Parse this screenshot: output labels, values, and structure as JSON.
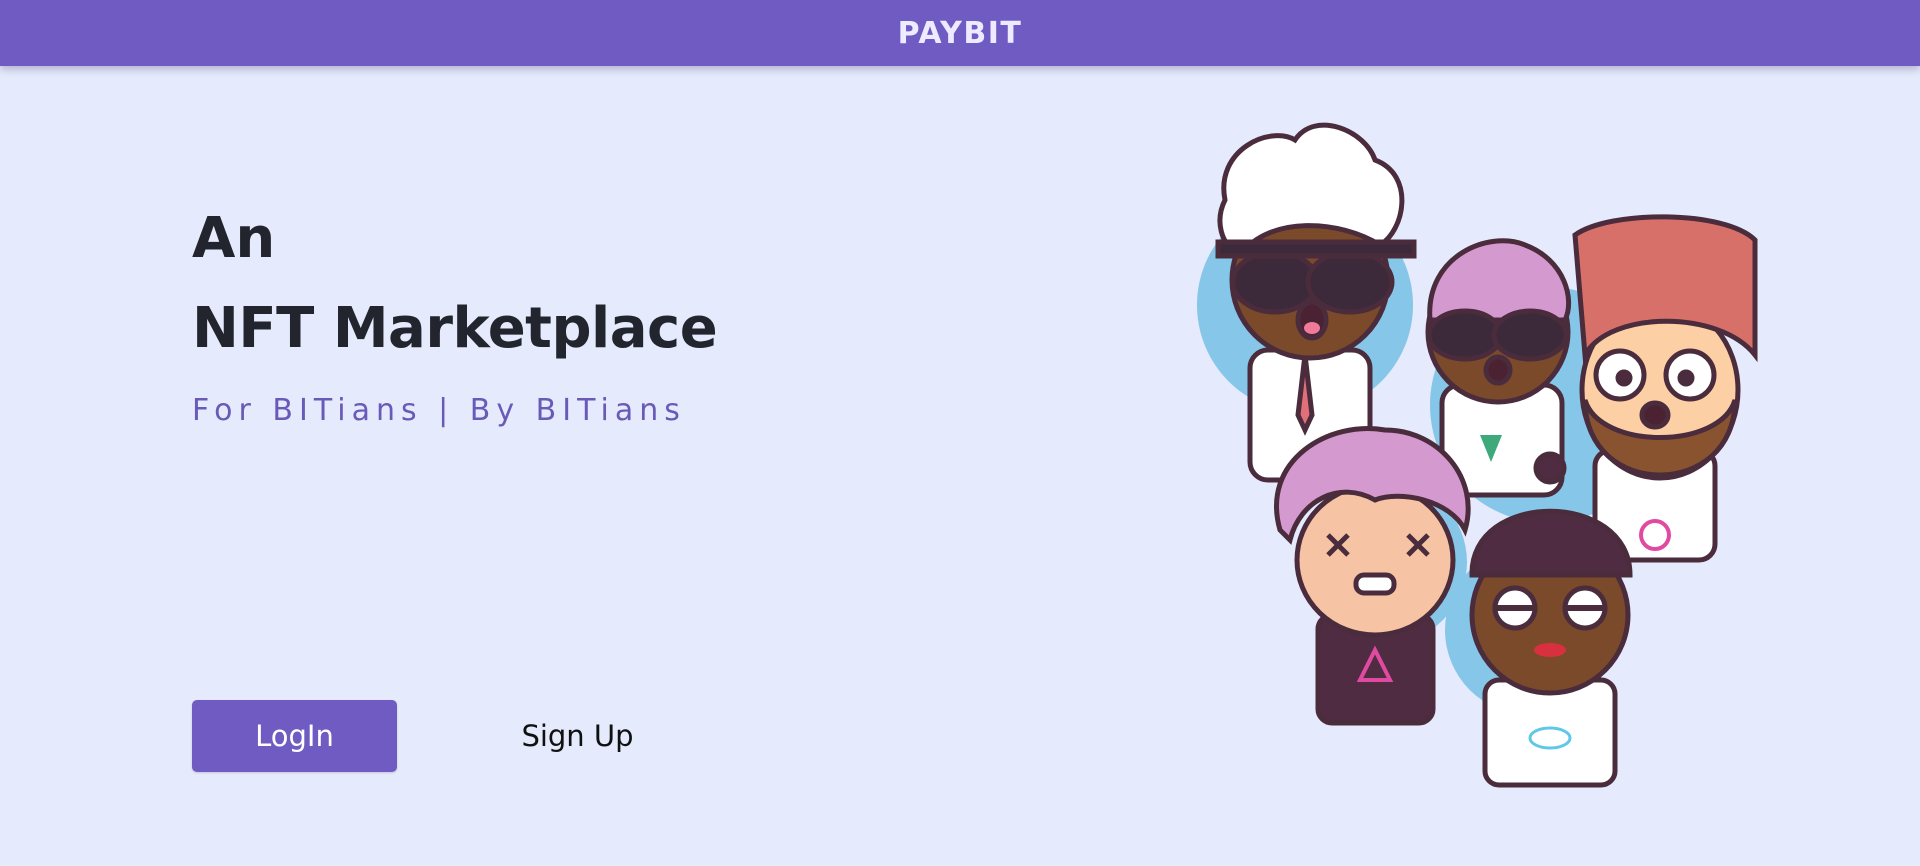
{
  "header": {
    "brand": "PAYBIT"
  },
  "hero": {
    "line1": "An",
    "line2": "NFT Marketplace",
    "tagline": "For BITians | By BITians"
  },
  "actions": {
    "login_label": "LogIn",
    "signup_label": "Sign Up"
  },
  "colors": {
    "accent": "#6f5bc1",
    "background": "#e5eafc",
    "heading": "#22252d",
    "tagline": "#6a5ab8"
  },
  "illustration": {
    "name": "nft-avatars-group"
  }
}
